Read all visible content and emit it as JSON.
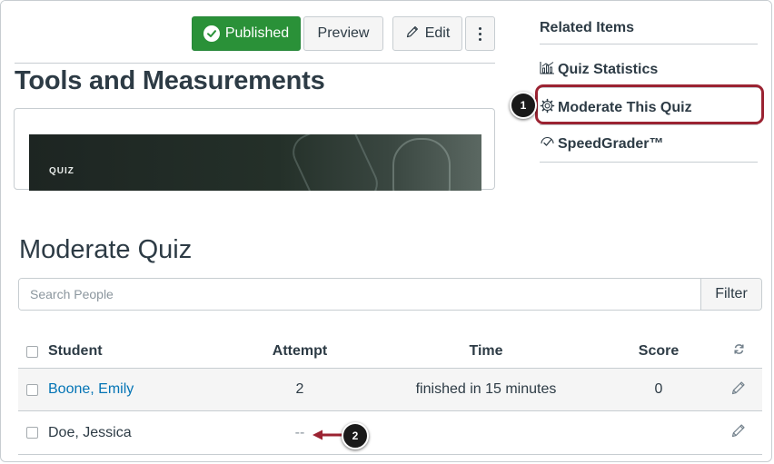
{
  "toolbar": {
    "published_label": "Published",
    "preview_label": "Preview",
    "edit_label": "Edit",
    "published_icon": "check-circle-icon",
    "edit_icon": "pencil-icon",
    "more_icon": "kebab-icon"
  },
  "quiz": {
    "title": "Tools and Measurements",
    "image_label": "QUIZ"
  },
  "related": {
    "heading": "Related Items",
    "items": [
      {
        "label": "Quiz Statistics",
        "icon": "statistics-chart-icon"
      },
      {
        "label": "Moderate This Quiz",
        "icon": "gear-icon"
      },
      {
        "label": "SpeedGrader™",
        "icon": "speedgrader-check-icon"
      }
    ]
  },
  "callouts": {
    "one": "1",
    "two": "2"
  },
  "moderate": {
    "title": "Moderate Quiz",
    "search_placeholder": "Search People",
    "filter_label": "Filter",
    "columns": {
      "student": "Student",
      "attempt": "Attempt",
      "time": "Time",
      "score": "Score"
    },
    "refresh_icon": "refresh-icon",
    "rows": [
      {
        "student": "Boone, Emily",
        "attempt": "2",
        "time": "finished in 15 minutes",
        "score": "0",
        "linked": true
      },
      {
        "student": "Doe, Jessica",
        "attempt": "--",
        "time": "",
        "score": "",
        "linked": false
      }
    ]
  },
  "colors": {
    "published_green": "#2a9138",
    "highlight_red": "#9b2332",
    "link_blue": "#0374b5",
    "text": "#2d3b45",
    "border": "#c7cdd1"
  }
}
